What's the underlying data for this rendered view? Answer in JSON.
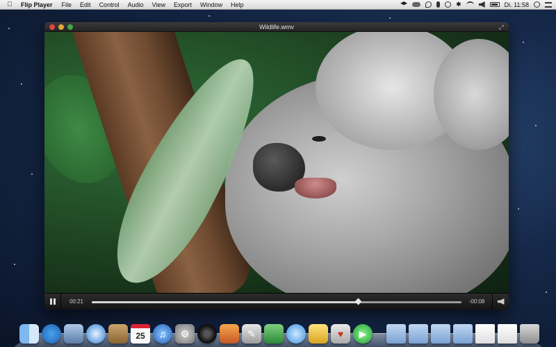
{
  "menubar": {
    "app_name": "Flip Player",
    "items": [
      "File",
      "Edit",
      "Control",
      "Audio",
      "View",
      "Export",
      "Window",
      "Help"
    ],
    "clock": "Di. 11:58"
  },
  "window": {
    "title": "Wildlife.wmv"
  },
  "playback": {
    "elapsed": "00:21",
    "remaining": "-00:08",
    "progress_percent": 72
  }
}
